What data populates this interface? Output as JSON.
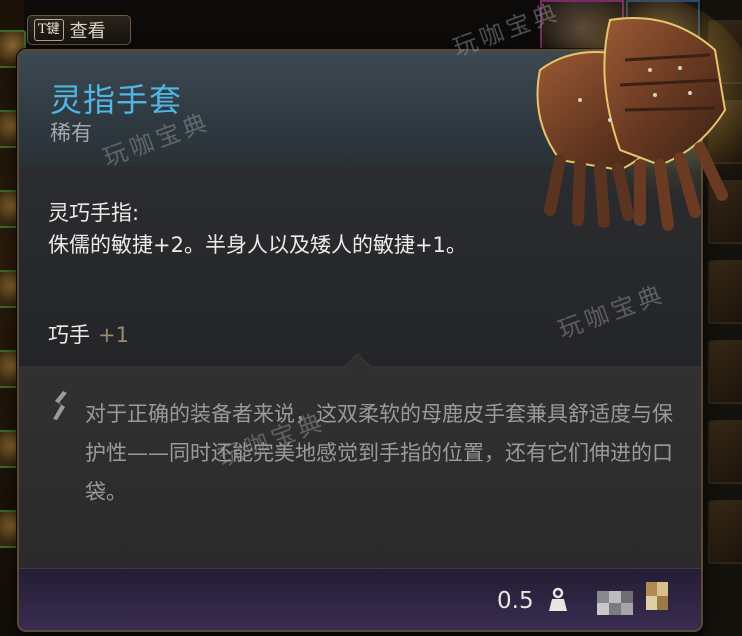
{
  "hint": {
    "key": "T键",
    "label": "查看"
  },
  "item": {
    "name": "灵指手套",
    "rarity": "稀有",
    "ability": {
      "name": "灵巧手指:",
      "description": "侏儒的敏捷+2。半身人以及矮人的敏捷+1。"
    },
    "bonus": {
      "name": "巧手",
      "value": "+1"
    },
    "lore": "对于正确的装备者来说，这双柔软的母鹿皮手套兼具舒适度与保护性——同时还能完美地感觉到手指的位置，还有它们伸进的口袋。",
    "weight": "0.5"
  },
  "watermark": "玩咖宝典",
  "colors": {
    "title": "#4fb7e6",
    "rarity": "#a6a7a8",
    "bonus_value": "#9c8a6d",
    "lore": "#9a9a97",
    "footer": "#3a2d52"
  },
  "icons": [
    "weight-icon",
    "quill-icon",
    "gloves-image"
  ]
}
